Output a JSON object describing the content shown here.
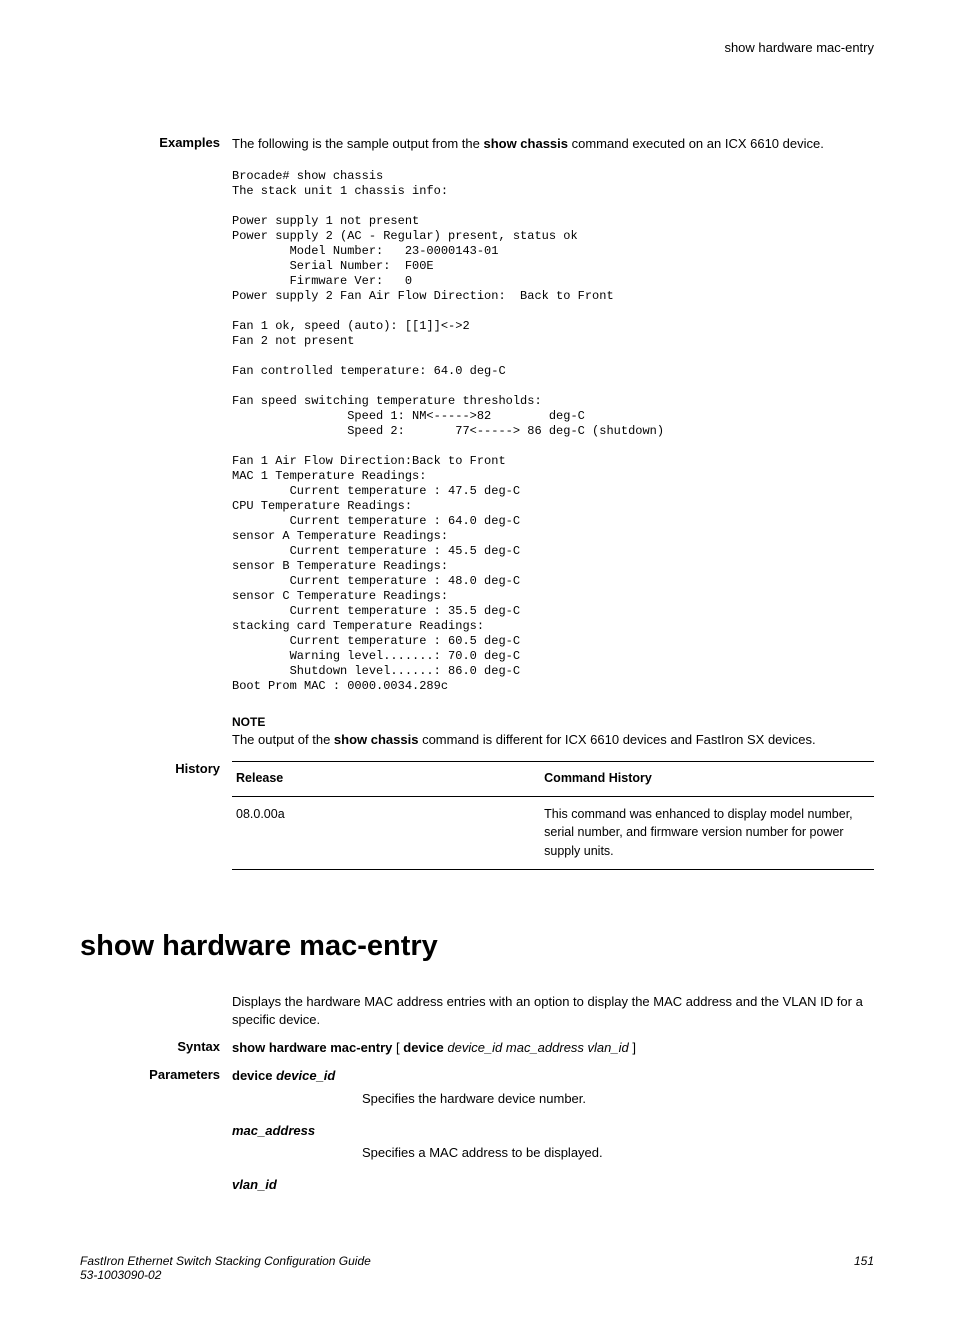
{
  "header": {
    "right": "show hardware mac-entry"
  },
  "examples": {
    "label": "Examples",
    "intro_pre": "The following is the sample output from the ",
    "intro_cmd": "show chassis",
    "intro_post": " command executed on an ICX 6610 device.",
    "code": "Brocade# show chassis\nThe stack unit 1 chassis info:\n\nPower supply 1 not present\nPower supply 2 (AC - Regular) present, status ok\n        Model Number:   23-0000143-01\n        Serial Number:  F00E\n        Firmware Ver:   0\nPower supply 2 Fan Air Flow Direction:  Back to Front\n\nFan 1 ok, speed (auto): [[1]]<->2\nFan 2 not present\n\nFan controlled temperature: 64.0 deg-C\n\nFan speed switching temperature thresholds:\n                Speed 1: NM<----->82        deg-C\n                Speed 2:       77<-----> 86 deg-C (shutdown)\n\nFan 1 Air Flow Direction:Back to Front\nMAC 1 Temperature Readings:\n        Current temperature : 47.5 deg-C\nCPU Temperature Readings:\n        Current temperature : 64.0 deg-C\nsensor A Temperature Readings:\n        Current temperature : 45.5 deg-C\nsensor B Temperature Readings:\n        Current temperature : 48.0 deg-C\nsensor C Temperature Readings:\n        Current temperature : 35.5 deg-C\nstacking card Temperature Readings:\n        Current temperature : 60.5 deg-C\n        Warning level.......: 70.0 deg-C\n        Shutdown level......: 86.0 deg-C\nBoot Prom MAC : 0000.0034.289c"
  },
  "note": {
    "label": "NOTE",
    "text_pre": "The output of the ",
    "text_cmd": "show chassis",
    "text_post": " command is different for ICX 6610 devices and FastIron SX devices."
  },
  "history": {
    "label": "History",
    "col1": "Release",
    "col2": "Command History",
    "row1_release": "08.0.00a",
    "row1_desc": "This command was enhanced to display model number, serial number, and firmware version number for power supply units."
  },
  "cmd": {
    "title": "show hardware mac-entry",
    "desc": "Displays the hardware MAC address entries with an option to display the MAC address and the VLAN ID for a specific device."
  },
  "syntax": {
    "label": "Syntax",
    "cmd": "show hardware mac-entry",
    "opt_kw": "device",
    "opt_var": "device_id mac_address vlan_id"
  },
  "params": {
    "label": "Parameters",
    "p1_kw": "device",
    "p1_var": "device_id",
    "p1_desc": "Specifies the hardware device number.",
    "p2_var": "mac_address",
    "p2_desc": "Specifies a MAC address to be displayed.",
    "p3_var": "vlan_id"
  },
  "footer": {
    "left1": "FastIron Ethernet Switch Stacking Configuration Guide",
    "left2": "53-1003090-02",
    "right": "151"
  }
}
